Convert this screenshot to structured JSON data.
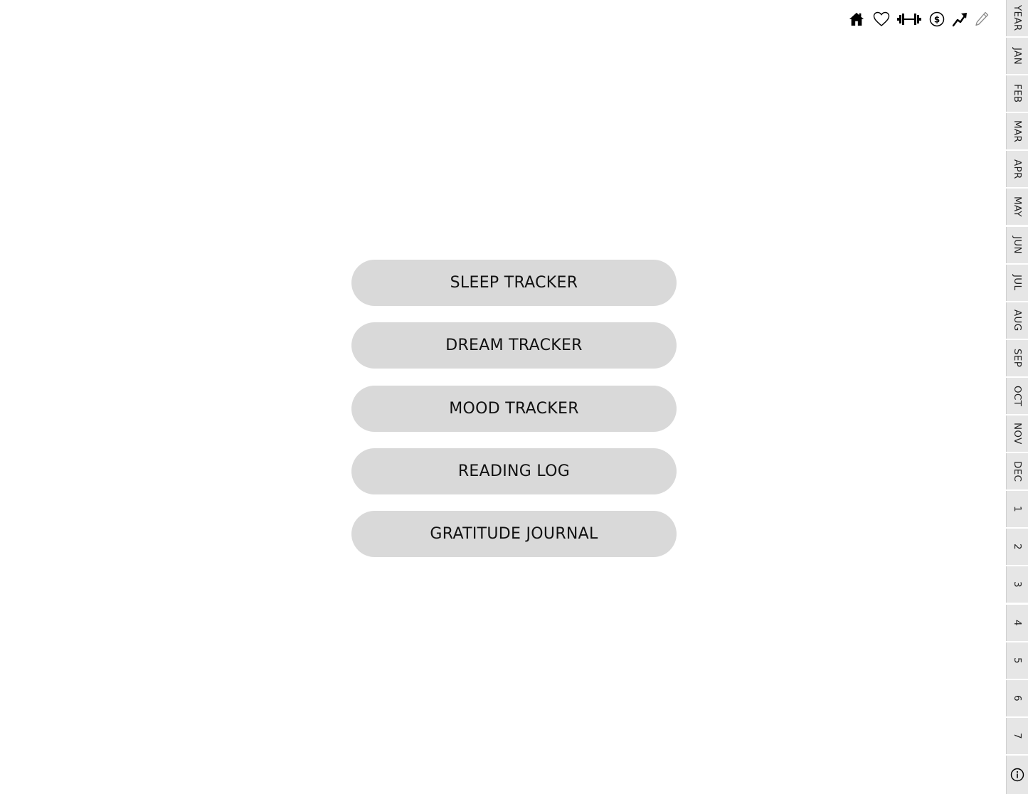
{
  "top_icons": [
    {
      "name": "home-icon"
    },
    {
      "name": "heart-icon"
    },
    {
      "name": "dumbbell-icon"
    },
    {
      "name": "dollar-icon"
    },
    {
      "name": "trend-up-icon"
    },
    {
      "name": "pencil-icon"
    }
  ],
  "menu": {
    "sleep_tracker": "SLEEP TRACKER",
    "dream_tracker": "DREAM TRACKER",
    "mood_tracker": "MOOD TRACKER",
    "reading_log": "READING LOG",
    "gratitude_journal": "GRATITUDE JOURNAL"
  },
  "tabs": {
    "year": "YEAR",
    "jan": "JAN",
    "feb": "FEB",
    "mar": "MAR",
    "apr": "APR",
    "may": "MAY",
    "jun": "JUN",
    "jul": "JUL",
    "aug": "AUG",
    "sep": "SEP",
    "oct": "OCT",
    "nov": "NOV",
    "dec": "DEC",
    "d1": "1",
    "d2": "2",
    "d3": "3",
    "d4": "4",
    "d5": "5",
    "d6": "6",
    "d7": "7"
  },
  "colors": {
    "button_bg": "#d9d9d9",
    "tab_bg": "#e6e6e6",
    "page_bg": "#ffffff",
    "text": "#111111"
  }
}
